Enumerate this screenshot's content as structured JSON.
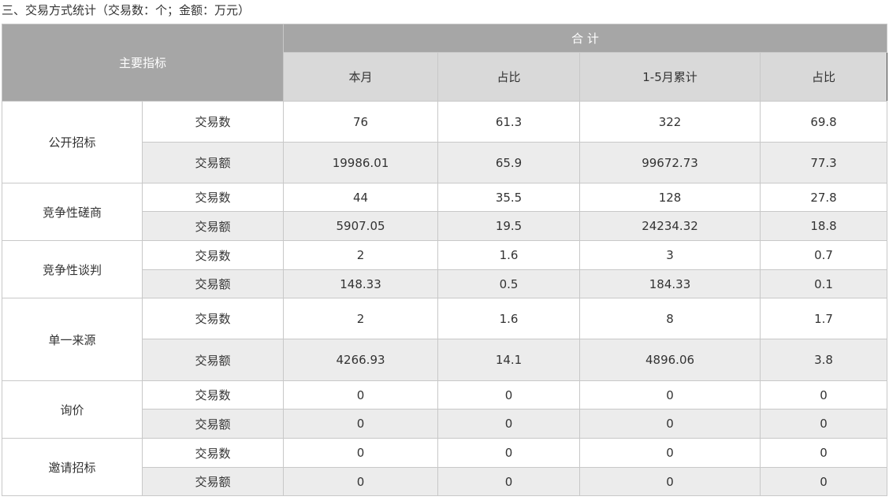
{
  "caption": "三、交易方式统计（交易数：个；金额：万元）",
  "header": {
    "main_indicator": "主要指标",
    "total": "合 计",
    "columns": [
      "本月",
      "占比",
      "1-5月累计",
      "占比"
    ]
  },
  "groups": [
    {
      "name": "公开招标",
      "rows": [
        {
          "metric": "交易数",
          "values": [
            "76",
            "61.3",
            "322",
            "69.8"
          ]
        },
        {
          "metric": "交易额",
          "values": [
            "19986.01",
            "65.9",
            "99672.73",
            "77.3"
          ]
        }
      ]
    },
    {
      "name": "竞争性磋商",
      "rows": [
        {
          "metric": "交易数",
          "values": [
            "44",
            "35.5",
            "128",
            "27.8"
          ]
        },
        {
          "metric": "交易额",
          "values": [
            "5907.05",
            "19.5",
            "24234.32",
            "18.8"
          ]
        }
      ]
    },
    {
      "name": "竞争性谈判",
      "rows": [
        {
          "metric": "交易数",
          "values": [
            "2",
            "1.6",
            "3",
            "0.7"
          ]
        },
        {
          "metric": "交易额",
          "values": [
            "148.33",
            "0.5",
            "184.33",
            "0.1"
          ]
        }
      ]
    },
    {
      "name": "单一来源",
      "rows": [
        {
          "metric": "交易数",
          "values": [
            "2",
            "1.6",
            "8",
            "1.7"
          ]
        },
        {
          "metric": "交易额",
          "values": [
            "4266.93",
            "14.1",
            "4896.06",
            "3.8"
          ]
        }
      ]
    },
    {
      "name": "询价",
      "rows": [
        {
          "metric": "交易数",
          "values": [
            "0",
            "0",
            "0",
            "0"
          ]
        },
        {
          "metric": "交易额",
          "values": [
            "0",
            "0",
            "0",
            "0"
          ]
        }
      ]
    },
    {
      "name": "邀请招标",
      "rows": [
        {
          "metric": "交易数",
          "values": [
            "0",
            "0",
            "0",
            "0"
          ]
        },
        {
          "metric": "交易额",
          "values": [
            "0",
            "0",
            "0",
            "0"
          ]
        }
      ]
    }
  ]
}
